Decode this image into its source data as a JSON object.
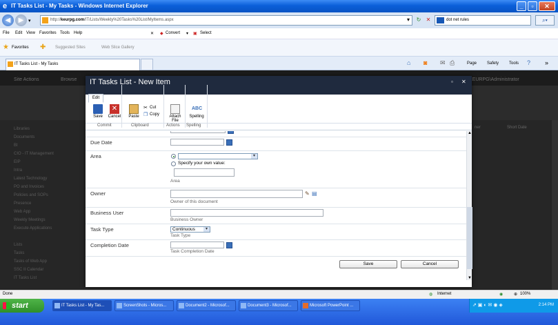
{
  "window": {
    "title": "IT Tasks List - My Tasks - Windows Internet Explorer"
  },
  "addressbar": {
    "url_prefix": "http://",
    "host": "keurpg.com",
    "url_rest": "/IT/Lists/Weekly%20Tasks%20List/MyItems.aspx",
    "search_value": "dot net rules"
  },
  "menubar": {
    "items": [
      "File",
      "Edit",
      "View",
      "Favorites",
      "Tools",
      "Help"
    ],
    "convert": "Convert",
    "select": "Select"
  },
  "favbar": {
    "favorites": "Favorites",
    "suggested": "Suggested Sites",
    "webslice": "Web Slice Gallery"
  },
  "tabs": {
    "active": "IT Tasks List - My Tasks"
  },
  "commandbar": {
    "page": "Page",
    "safety": "Safety",
    "tools": "Tools"
  },
  "background": {
    "site_actions": "Site Actions",
    "browse": "Browse",
    "user": "KEURPG\\Administrator",
    "quick_links": [
      "Libraries",
      "Documents",
      "BI",
      "CIO - IT Management",
      "EIP",
      "Intra",
      "Latest Technology",
      "PO and Invoices",
      "Policies and SOPs",
      "Presence",
      "Web App",
      "Weekly Meetings",
      "Execute Applications",
      "Lists",
      "Tasks",
      "Tasks of Web App",
      "SSC II Calendar",
      "IT Tasks List"
    ],
    "right_col_header": "Short Date",
    "right_col_header2": "ner"
  },
  "dialog": {
    "title": "IT Tasks List - New Item",
    "tab_edit": "Edit",
    "ribbon": {
      "save": "Save",
      "cancel": "Cancel",
      "paste": "Paste",
      "cut": "Cut",
      "copy": "Copy",
      "attach_file": "Attach File",
      "spelling": "Spelling"
    },
    "groups": [
      "Commit",
      "Clipboard",
      "Actions",
      "Spelling"
    ],
    "fields": {
      "due_date": {
        "label": "Due Date"
      },
      "area": {
        "label": "Area",
        "specify_option": "Specify your own value:",
        "desc": "Area"
      },
      "owner": {
        "label": "Owner",
        "desc": "Owner of this document"
      },
      "business_user": {
        "label": "Business User",
        "desc": "Business Owner"
      },
      "task_type": {
        "label": "Task Type",
        "value": "Continuous",
        "desc": "Task Type"
      },
      "completion_date": {
        "label": "Completion Date",
        "desc": "Task Completion Date"
      }
    },
    "buttons": {
      "save": "Save",
      "cancel": "Cancel"
    }
  },
  "statusbar": {
    "left": "Done",
    "zone": "Internet",
    "zoom": "100%"
  },
  "taskbar": {
    "start": "start",
    "buttons": [
      "IT Tasks List - My Tas...",
      "ScreenShots - Micros...",
      "Document2 - Microsof...",
      "Document3 - Microsof...",
      "Microsoft PowerPoint ..."
    ],
    "clock": "2:14 PM"
  }
}
